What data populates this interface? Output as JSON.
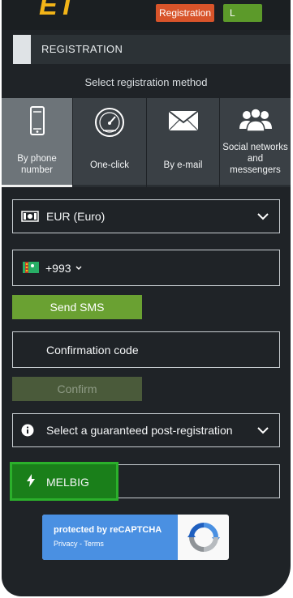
{
  "topbar": {
    "logo_text": "ET",
    "registration_label": "Registration",
    "login_label": "L"
  },
  "header": {
    "title": "REGISTRATION",
    "method_title": "Select registration method"
  },
  "tabs": [
    {
      "label": "By phone number",
      "icon": "phone-icon",
      "active": true
    },
    {
      "label": "One-click",
      "icon": "speedometer-icon",
      "active": false
    },
    {
      "label": "By e-mail",
      "icon": "envelope-icon",
      "active": false
    },
    {
      "label": "Social networks and messengers",
      "icon": "people-icon",
      "active": false
    }
  ],
  "form": {
    "currency": "EUR (Euro)",
    "phone_code": "+993",
    "send_sms_label": "Send SMS",
    "confirmation_placeholder": "Confirmation code",
    "confirm_label": "Confirm",
    "bonus_select": "Select a guaranteed post-registration",
    "promo_code": "MELBIG"
  },
  "recaptcha": {
    "title": "protected by reCAPTCHA",
    "links": "Privacy - Terms"
  },
  "colors": {
    "background": "#1f2327",
    "accent_green": "#6aa132",
    "registration_orange": "#d8542a",
    "recaptcha_blue": "#4a90e2"
  }
}
